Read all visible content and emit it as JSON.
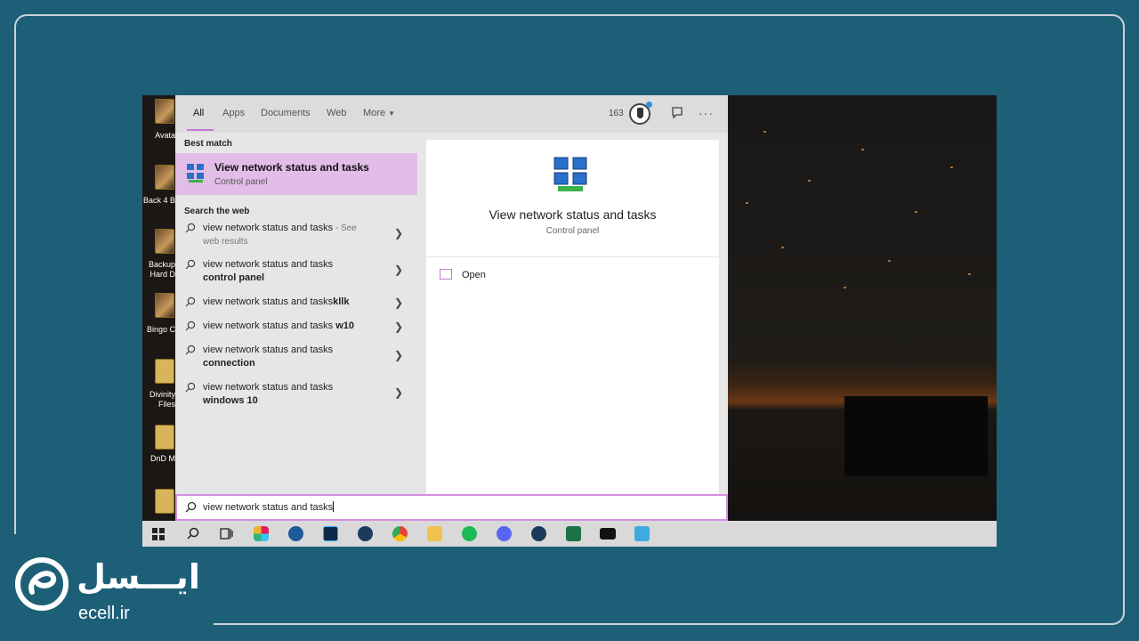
{
  "tabs": {
    "all": "All",
    "apps": "Apps",
    "documents": "Documents",
    "web": "Web",
    "more": "More",
    "points": "163"
  },
  "left": {
    "best_match_heading": "Best match",
    "best_match_title": "View network status and tasks",
    "best_match_subtitle": "Control panel",
    "search_web_heading": "Search the web",
    "web_results": [
      {
        "prefix": "view network status and tasks",
        "bold": "",
        "suffix": " - See",
        "line2": "web results"
      },
      {
        "prefix": "view network status and tasks",
        "bold": "control panel",
        "suffix": "",
        "line2": ""
      },
      {
        "prefix": "view network status and tasks",
        "bold": "kllk",
        "suffix": "",
        "line2": ""
      },
      {
        "prefix": "view network status and tasks ",
        "bold": "w10",
        "suffix": "",
        "line2": ""
      },
      {
        "prefix": "view network status and tasks",
        "bold": "connection",
        "suffix": "",
        "line2": ""
      },
      {
        "prefix": "view network status and tasks",
        "bold": "windows 10",
        "suffix": "",
        "line2": ""
      }
    ]
  },
  "right": {
    "title": "View network status and tasks",
    "subtitle": "Control panel",
    "open_label": "Open"
  },
  "search": {
    "query": "view network status and tasks"
  },
  "desktop": {
    "labels": [
      "Avata",
      "Back 4 B",
      "Backup\nHard D",
      "Bingo C",
      "Divinity\nFiles",
      "DnD M"
    ]
  },
  "taskbar_icons": [
    "windows-start-icon",
    "search-icon",
    "task-view-icon",
    "slack-icon",
    "app-circle-icon",
    "photoshop-icon",
    "steam-icon",
    "chrome-icon",
    "file-explorer-icon",
    "spotify-icon",
    "discord-icon",
    "steam-icon",
    "excel-icon",
    "terminal-icon",
    "remote-desktop-icon"
  ],
  "logo": {
    "arabic": "ایـــسل",
    "site": "ecell.ir"
  },
  "colors": {
    "background": "#1e5f78",
    "highlight": "#e2bde8",
    "accent": "#c77bd6"
  }
}
